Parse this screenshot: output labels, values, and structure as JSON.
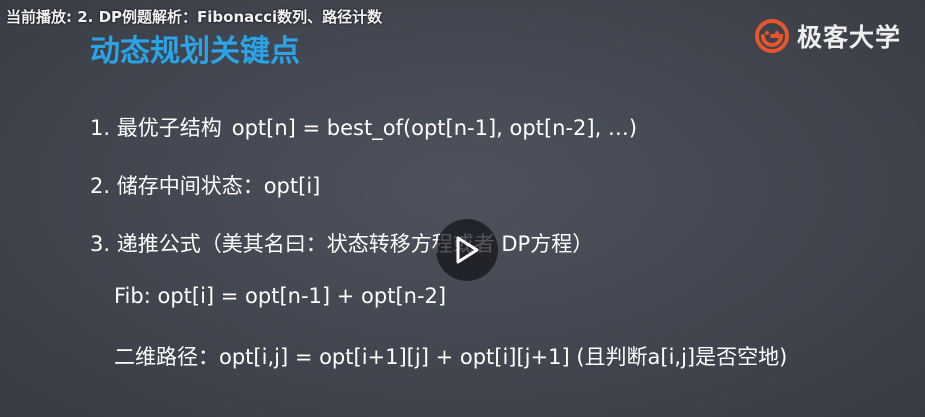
{
  "header": {
    "now_playing": "当前播放: 2. DP例题解析：Fibonacci数列、路径计数"
  },
  "brand": {
    "name": "极客大学",
    "color": "#e8552b"
  },
  "slide": {
    "title": "动态规划关键点",
    "title_color": "#2aa4e6",
    "points": [
      {
        "label": "1. 最优子结构",
        "formula": "opt[n] = best_of(opt[n-1], opt[n-2], …)"
      },
      {
        "text": "2. 储存中间状态：opt[i]"
      },
      {
        "text": "3. 递推公式（美其名曰：状态转移方程或者 DP方程）"
      },
      {
        "text": "Fib: opt[i] = opt[n-1] + opt[n-2]"
      },
      {
        "text": "二维路径：opt[i,j] = opt[i+1][j] + opt[i][j+1] (且判断a[i,j]是否空地)"
      }
    ]
  },
  "player": {
    "play_icon": "play-icon"
  }
}
